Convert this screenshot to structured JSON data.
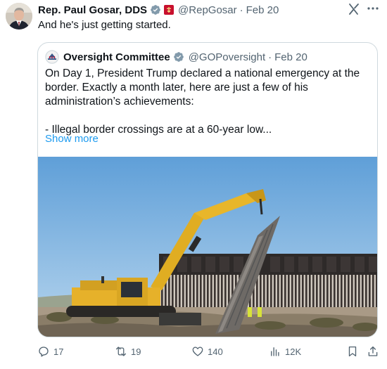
{
  "tweet": {
    "author_name": "Rep. Paul Gosar, DDS",
    "author_handle": "@RepGosar",
    "separator": "·",
    "date": "Feb 20",
    "text": "And he's just getting started."
  },
  "quote": {
    "author_name": "Oversight Committee",
    "author_handle": "@GOPoversight",
    "separator": "·",
    "date": "Feb 20",
    "paragraph_1": "On Day 1, President Trump declared a national emergency at the border. Exactly a month later, here are just a few of his administration’s achievements:",
    "paragraph_2": "- Illegal border crossings are at a 60-year low...",
    "show_more": "Show more"
  },
  "actions": {
    "replies": "17",
    "reposts": "19",
    "likes": "140",
    "views": "12K"
  },
  "icons": {
    "verified": "verified-badge-icon",
    "flag": "house-flag-icon",
    "grok": "grok-icon",
    "more": "more-icon",
    "reply": "reply-icon",
    "repost": "repost-icon",
    "like": "heart-icon",
    "views": "views-icon",
    "bookmark": "bookmark-icon",
    "share": "share-icon"
  },
  "colors": {
    "text": "#0f1419",
    "muted": "#536471",
    "link": "#1d9bf0",
    "verified": "#829aab",
    "border": "#cfd9de"
  }
}
